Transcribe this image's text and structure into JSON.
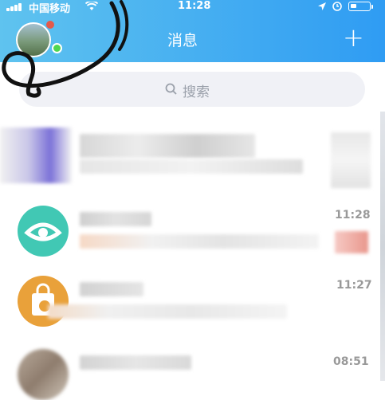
{
  "status_bar": {
    "carrier": "中国移动",
    "time": "11:28",
    "icons": [
      "signal-icon",
      "wifi-icon",
      "location-icon",
      "alarm-icon",
      "battery-icon"
    ]
  },
  "header": {
    "title": "消息",
    "add_icon": "plus-icon",
    "background": "#3fa9f5"
  },
  "search": {
    "placeholder": "搜索",
    "icon": "search-icon"
  },
  "conversations": [
    {
      "time": ""
    },
    {
      "time": "11:28",
      "accent": "#41c8b4"
    },
    {
      "time": "11:27",
      "accent": "#e9a13a"
    },
    {
      "time": "08:51"
    }
  ],
  "colors": {
    "unread_indicator": "#e35a4b",
    "online_indicator": "#4fd64f"
  }
}
